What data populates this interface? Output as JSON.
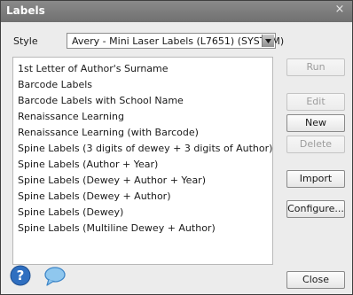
{
  "window": {
    "title": "Labels",
    "close_glyph": "×"
  },
  "style": {
    "label": "Style",
    "selected": "Avery - Mini Laser Labels (L7651) (SYSTEM)"
  },
  "labels_list": [
    "1st Letter of Author's Surname",
    "Barcode Labels",
    "Barcode Labels with School Name",
    "Renaissance Learning",
    "Renaissance Learning (with Barcode)",
    "Spine Labels (3 digits of dewey + 3 digits of Author)",
    "Spine Labels (Author + Year)",
    "Spine Labels (Dewey + Author + Year)",
    "Spine Labels (Dewey + Author)",
    "Spine Labels (Dewey)",
    "Spine Labels (Multiline Dewey + Author)"
  ],
  "buttons": {
    "run": "Run",
    "edit": "Edit",
    "new": "New",
    "delete": "Delete",
    "import": "Import",
    "configure": "Configure...",
    "close": "Close"
  },
  "icons": {
    "help": "help-icon",
    "chat": "chat-icon",
    "dropdown": "chevron-down-icon",
    "close": "close-icon"
  },
  "colors": {
    "titlebar": "#7a7a7a",
    "dialog_bg": "#ececec",
    "help_blue": "#2f6fc0"
  }
}
